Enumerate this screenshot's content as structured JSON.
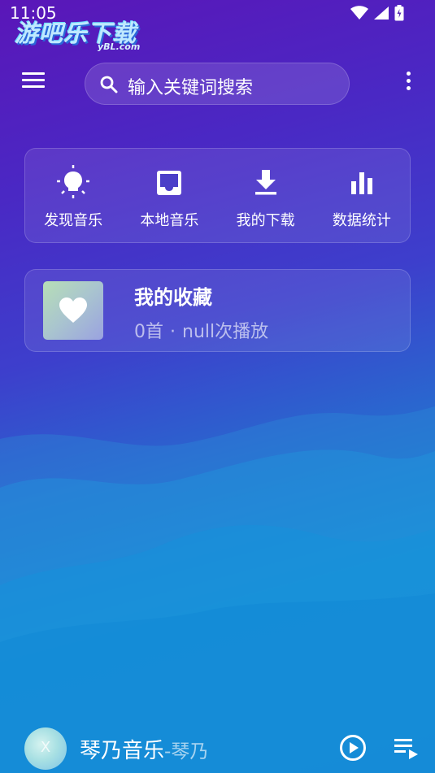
{
  "status_bar": {
    "time": "11:05"
  },
  "watermark": {
    "main": "游吧乐下载",
    "sub": "yBL.com"
  },
  "top_bar": {
    "search_placeholder": "输入关键词搜索"
  },
  "quick_nav": {
    "items": [
      {
        "label": "发现音乐",
        "icon": "lightbulb-icon"
      },
      {
        "label": "本地音乐",
        "icon": "inbox-icon"
      },
      {
        "label": "我的下载",
        "icon": "download-icon"
      },
      {
        "label": "数据统计",
        "icon": "bar-chart-icon"
      }
    ]
  },
  "favorites": {
    "title": "我的收藏",
    "count": "0首",
    "separator": "·",
    "plays": "null次播放"
  },
  "player": {
    "avatar_letter": "X",
    "title": "琴乃音乐",
    "artist": "-琴乃"
  },
  "colors": {
    "background_top": "#5a16b8",
    "background_bottom": "#1a7fd6",
    "text_primary": "#ffffff"
  }
}
